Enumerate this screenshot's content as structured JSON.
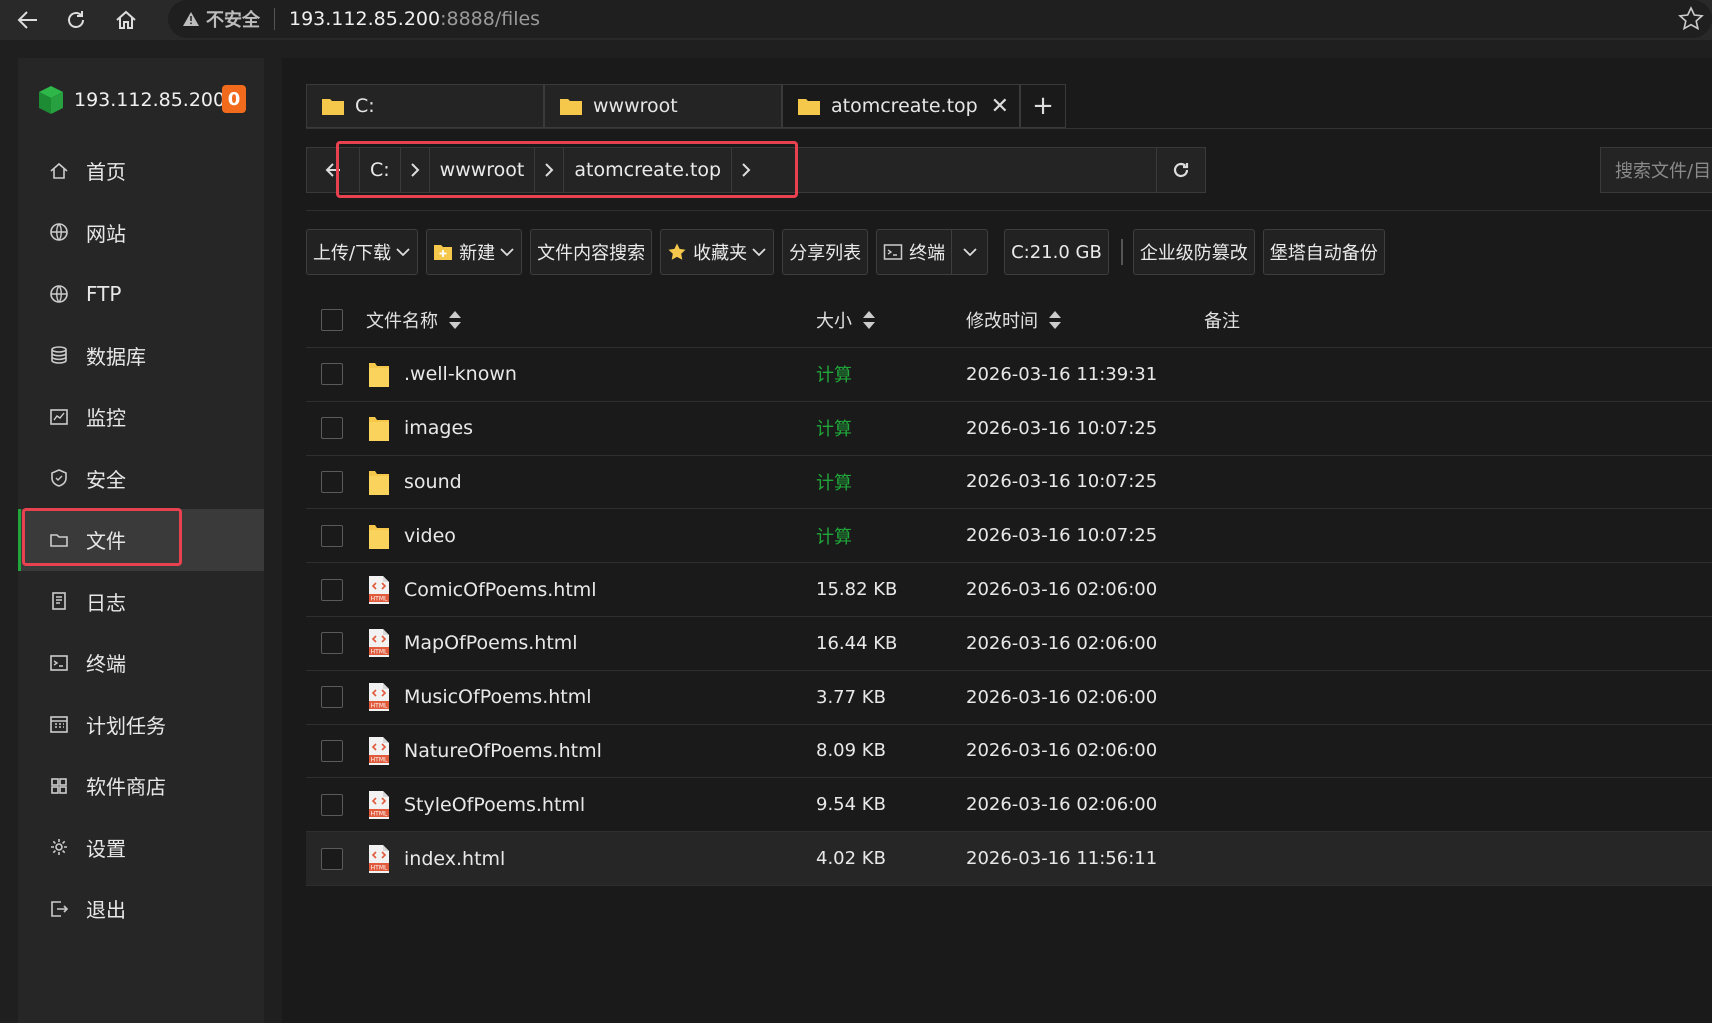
{
  "browser": {
    "security_label": "不安全",
    "url_host": "193.112.85.200",
    "url_rest": ":8888/files"
  },
  "sidebar": {
    "server": "193.112.85.200",
    "badge": "0",
    "items": [
      {
        "label": "首页",
        "icon": "home-icon"
      },
      {
        "label": "网站",
        "icon": "globe-icon"
      },
      {
        "label": "FTP",
        "icon": "ftp-globe-icon"
      },
      {
        "label": "数据库",
        "icon": "database-icon"
      },
      {
        "label": "监控",
        "icon": "monitor-icon"
      },
      {
        "label": "安全",
        "icon": "shield-icon"
      },
      {
        "label": "文件",
        "icon": "folder-icon"
      },
      {
        "label": "日志",
        "icon": "log-icon"
      },
      {
        "label": "终端",
        "icon": "terminal-icon"
      },
      {
        "label": "计划任务",
        "icon": "calendar-icon"
      },
      {
        "label": "软件商店",
        "icon": "apps-icon"
      },
      {
        "label": "设置",
        "icon": "gear-icon"
      },
      {
        "label": "退出",
        "icon": "logout-icon"
      }
    ],
    "active_index": 6
  },
  "tabs": [
    {
      "label": "C:"
    },
    {
      "label": "wwwroot"
    },
    {
      "label": "atomcreate.top"
    }
  ],
  "path": {
    "crumbs": [
      "C:",
      "wwwroot",
      "atomcreate.top"
    ]
  },
  "search": {
    "placeholder": "搜索文件/目"
  },
  "toolbar": {
    "upload": "上传/下载",
    "create": "新建",
    "content_search": "文件内容搜索",
    "favorites": "收藏夹",
    "share_list": "分享列表",
    "terminal": "终端",
    "disk": "C:21.0 GB",
    "tamper": "企业级防篡改",
    "backup": "堡塔自动备份"
  },
  "table": {
    "headers": {
      "name": "文件名称",
      "size": "大小",
      "time": "修改时间",
      "note": "备注"
    },
    "rows": [
      {
        "name": ".well-known",
        "type": "folder",
        "size": "计算",
        "time": "2026-03-16 11:39:31"
      },
      {
        "name": "images",
        "type": "folder",
        "size": "计算",
        "time": "2026-03-16 10:07:25"
      },
      {
        "name": "sound",
        "type": "folder",
        "size": "计算",
        "time": "2026-03-16 10:07:25"
      },
      {
        "name": "video",
        "type": "folder",
        "size": "计算",
        "time": "2026-03-16 10:07:25"
      },
      {
        "name": "ComicOfPoems.html",
        "type": "html",
        "size": "15.82 KB",
        "time": "2026-03-16 02:06:00"
      },
      {
        "name": "MapOfPoems.html",
        "type": "html",
        "size": "16.44 KB",
        "time": "2026-03-16 02:06:00"
      },
      {
        "name": "MusicOfPoems.html",
        "type": "html",
        "size": "3.77 KB",
        "time": "2026-03-16 02:06:00"
      },
      {
        "name": "NatureOfPoems.html",
        "type": "html",
        "size": "8.09 KB",
        "time": "2026-03-16 02:06:00"
      },
      {
        "name": "StyleOfPoems.html",
        "type": "html",
        "size": "9.54 KB",
        "time": "2026-03-16 02:06:00"
      },
      {
        "name": "index.html",
        "type": "html",
        "size": "4.02 KB",
        "time": "2026-03-16 11:56:11"
      }
    ]
  },
  "colors": {
    "accent_green": "#20a53a",
    "highlight_red": "#e8414f",
    "badge_orange": "#f26b1d",
    "folder_yellow": "#f5c84b"
  }
}
